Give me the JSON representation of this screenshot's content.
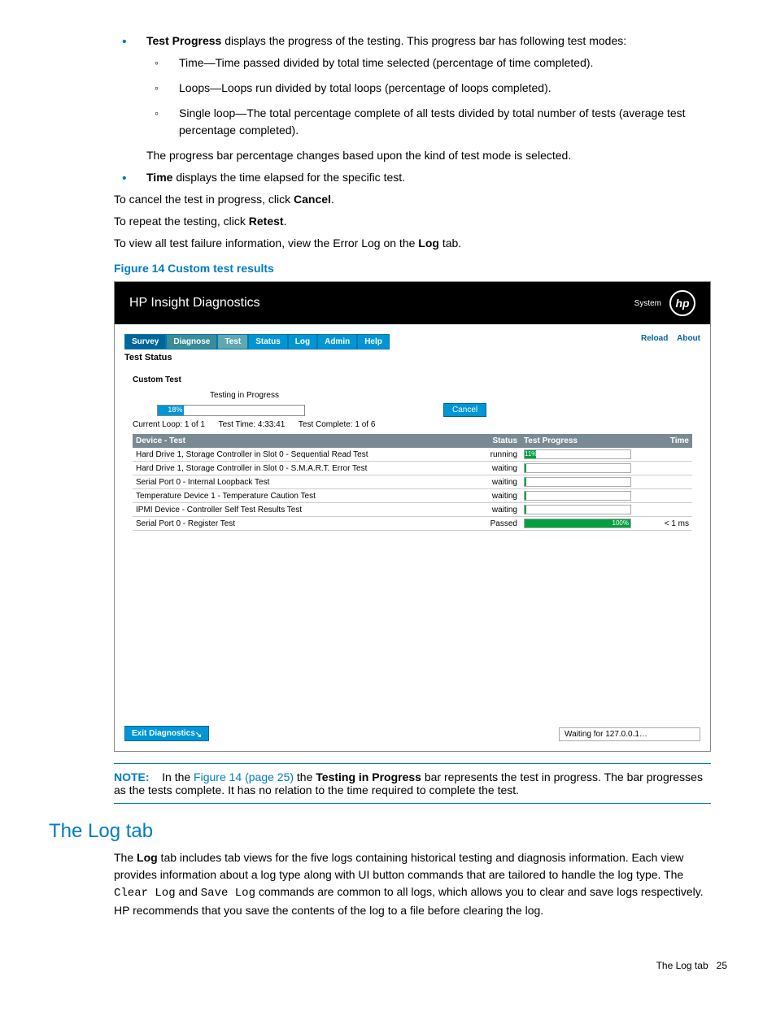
{
  "bullets": {
    "item1_lead": "Test Progress",
    "item1_text": " displays the progress of the testing. This progress bar has following test modes:",
    "sub1": "Time—Time passed divided by total time selected (percentage of time completed).",
    "sub2": "Loops—Loops run divided by total loops (percentage of loops completed).",
    "sub3": "Single loop—The total percentage complete of all tests divided by total number of tests (average test percentage completed).",
    "item1_after": "The progress bar percentage changes based upon the kind of test mode is selected.",
    "item2_lead": "Time",
    "item2_text": " displays the time elapsed for the specific test."
  },
  "lines": {
    "l1a": "To cancel the test in progress, click ",
    "l1b": "Cancel",
    "l1c": ".",
    "l2a": "To repeat the testing, click ",
    "l2b": "Retest",
    "l2c": ".",
    "l3a": "To view all test failure information, view the Error Log on the ",
    "l3b": "Log",
    "l3c": " tab."
  },
  "figure_title": "Figure 14 Custom test results",
  "app": {
    "title": "HP Insight Diagnostics",
    "system": "System",
    "logo": "hp",
    "tabs": [
      "Survey",
      "Diagnose",
      "Test",
      "Status",
      "Log",
      "Admin",
      "Help"
    ],
    "reload": "Reload",
    "about": "About",
    "test_status": "Test Status",
    "custom_test": "Custom Test",
    "progress_label": "Testing in Progress",
    "progress_pct": "18%",
    "cancel": "Cancel",
    "info_loop": "Current Loop: 1 of 1",
    "info_time": "Test Time: 4:33:41",
    "info_complete": "Test Complete: 1 of 6",
    "th_device": "Device - Test",
    "th_status": "Status",
    "th_progress": "Test Progress",
    "th_time": "Time",
    "rows": [
      {
        "name": "Hard Drive 1, Storage Controller in Slot 0 - Sequential Read Test",
        "status": "running",
        "pct": "11%",
        "pctw": 11,
        "time": ""
      },
      {
        "name": "Hard Drive 1, Storage Controller in Slot 0 - S.M.A.R.T. Error Test",
        "status": "waiting",
        "pct": "",
        "pctw": 0,
        "time": ""
      },
      {
        "name": "Serial Port 0 - Internal Loopback Test",
        "status": "waiting",
        "pct": "",
        "pctw": 0,
        "time": ""
      },
      {
        "name": "Temperature Device 1 - Temperature Caution Test",
        "status": "waiting",
        "pct": "",
        "pctw": 0,
        "time": ""
      },
      {
        "name": "IPMI Device - Controller Self Test Results Test",
        "status": "waiting",
        "pct": "",
        "pctw": 0,
        "time": ""
      },
      {
        "name": "Serial Port 0 - Register Test",
        "status": "Passed",
        "pct": "100%",
        "pctw": 100,
        "time": "< 1 ms"
      }
    ],
    "exit": "Exit Diagnostics",
    "statusbar": "Waiting for 127.0.0.1…"
  },
  "note": {
    "label": "NOTE:",
    "t1": "In the ",
    "link": "Figure 14 (page 25)",
    "t2": " the ",
    "bold": "Testing in Progress",
    "t3": " bar represents the test in progress. The bar progresses as the tests complete. It has no relation to the time required to complete the test."
  },
  "section_h": "The Log tab",
  "log_para": {
    "t1": "The ",
    "b1": "Log",
    "t2": " tab includes tab views for the five logs containing historical testing and diagnosis information. Each view provides information about a log type along with UI button commands that are tailored to handle the log type. The ",
    "m1": "Clear Log",
    "t3": " and ",
    "m2": "Save Log",
    "t4": " commands are common to all logs, which allows you to clear and save logs respectively. HP recommends that you save the contents of the log to a file before clearing the log."
  },
  "footer": {
    "label": "The Log tab",
    "page": "25"
  }
}
